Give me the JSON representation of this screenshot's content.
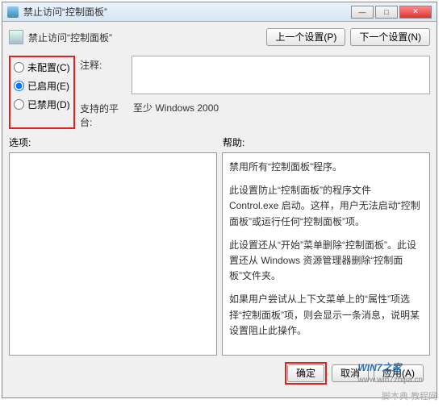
{
  "titlebar": {
    "text": "禁止访问“控制面板”"
  },
  "header": {
    "text": "禁止访问“控制面板”"
  },
  "nav": {
    "prev": "上一个设置(P)",
    "next": "下一个设置(N)"
  },
  "radios": {
    "notconfigured": "未配置(C)",
    "enabled": "已启用(E)",
    "disabled": "已禁用(D)"
  },
  "fields": {
    "comment_label": "注释:",
    "comment_value": "",
    "platform_label": "支持的平台:",
    "platform_value": "至少 Windows 2000"
  },
  "section_labels": {
    "options": "选项:",
    "help": "帮助:"
  },
  "help": {
    "p1": "禁用所有“控制面板”程序。",
    "p2": "此设置防止“控制面板”的程序文件 Control.exe 启动。这样，用户无法启动“控制面板”或运行任何“控制面板”项。",
    "p3": "此设置还从“开始”菜单删除“控制面板”。此设置还从 Windows 资源管理器删除“控制面板”文件夹。",
    "p4": "如果用户尝试从上下文菜单上的“属性”项选择“控制面板”项，则会显示一条消息，说明某设置阻止此操作。"
  },
  "footer": {
    "ok": "确定",
    "cancel": "取消",
    "apply": "应用(A)"
  },
  "watermark": {
    "main": "WIN7之家",
    "sub": "www.win7zhijia.cn"
  },
  "extra_wm": "脚本典 教程网"
}
